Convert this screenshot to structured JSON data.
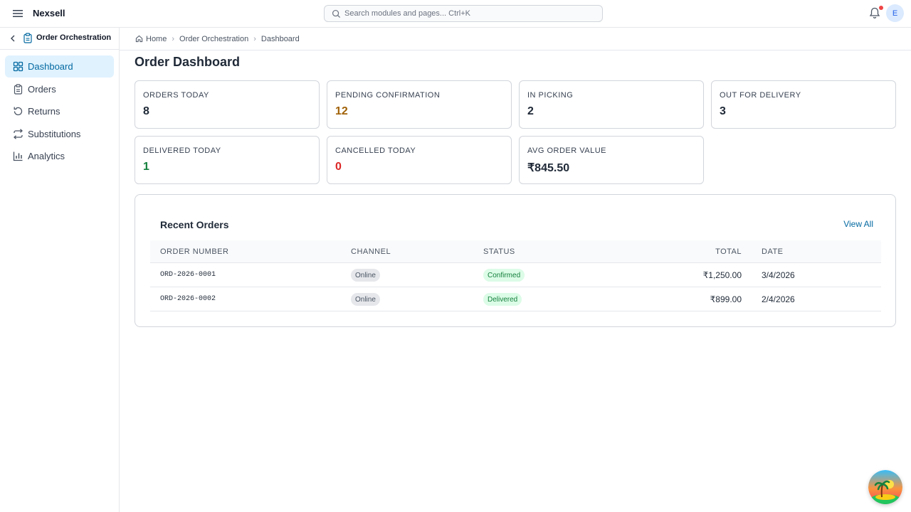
{
  "header": {
    "app_name": "Nexsell",
    "search_placeholder": "Search modules and pages... Ctrl+K",
    "avatar_initial": "E"
  },
  "sidebar": {
    "module_title": "Order Orchestration",
    "items": [
      {
        "label": "Dashboard",
        "icon": "grid-icon",
        "active": true
      },
      {
        "label": "Orders",
        "icon": "clipboard-icon"
      },
      {
        "label": "Returns",
        "icon": "rotate-icon"
      },
      {
        "label": "Substitutions",
        "icon": "swap-icon"
      },
      {
        "label": "Analytics",
        "icon": "bar-chart-icon"
      }
    ]
  },
  "breadcrumb": [
    "Home",
    "Order Orchestration",
    "Dashboard"
  ],
  "page_title": "Order Dashboard",
  "stats": [
    {
      "label": "ORDERS TODAY",
      "value": "8",
      "color": "#1f2937"
    },
    {
      "label": "PENDING CONFIRMATION",
      "value": "12",
      "color": "#a16207"
    },
    {
      "label": "IN PICKING",
      "value": "2",
      "color": "#1f2937"
    },
    {
      "label": "OUT FOR DELIVERY",
      "value": "3",
      "color": "#1f2937"
    },
    {
      "label": "DELIVERED TODAY",
      "value": "1",
      "color": "#15803d"
    },
    {
      "label": "CANCELLED TODAY",
      "value": "0",
      "color": "#dc2626"
    },
    {
      "label": "AVG ORDER VALUE",
      "value": "₹845.50",
      "color": "#1f2937"
    }
  ],
  "recent_orders": {
    "title": "Recent Orders",
    "view_all": "View All",
    "columns": [
      "ORDER NUMBER",
      "CHANNEL",
      "STATUS",
      "TOTAL",
      "DATE"
    ],
    "rows": [
      {
        "order_number": "ORD-2026-0001",
        "channel": "Online",
        "status": "Confirmed",
        "total": "₹1,250.00",
        "date": "3/4/2026"
      },
      {
        "order_number": "ORD-2026-0002",
        "channel": "Online",
        "status": "Delivered",
        "total": "₹899.00",
        "date": "2/4/2026"
      }
    ]
  },
  "colors": {
    "accent": "#0369a1",
    "active_bg": "#e0f2fe",
    "notification_dot": "#ef4444"
  }
}
